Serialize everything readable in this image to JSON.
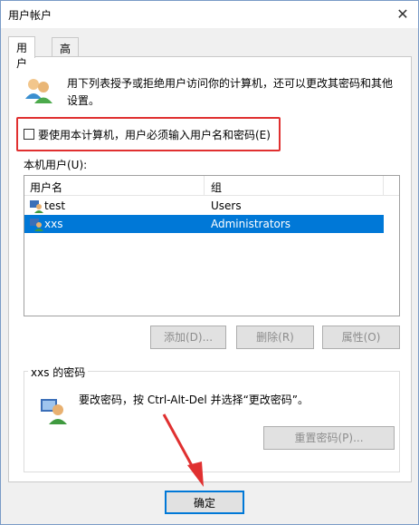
{
  "window": {
    "title": "用户帐户",
    "close_glyph": "✕"
  },
  "tabs": [
    {
      "label": "用户",
      "active": true
    },
    {
      "label": "高级",
      "active": false
    }
  ],
  "users_tab": {
    "description": "用下列表授予或拒绝用户访问你的计算机，还可以更改其密码和其他设置。",
    "require_login_checkbox": {
      "label": "要使用本计算机，用户必须输入用户名和密码(E)",
      "checked": false
    },
    "local_users_label": "本机用户(U):",
    "table": {
      "columns": [
        "用户名",
        "组"
      ],
      "rows": [
        {
          "name": "test",
          "group": "Users",
          "selected": false
        },
        {
          "name": "xxs",
          "group": "Administrators",
          "selected": true
        }
      ]
    },
    "buttons": {
      "add": "添加(D)...",
      "remove": "删除(R)",
      "properties": "属性(O)"
    },
    "password_group": {
      "title": "xxs 的密码",
      "text": "要改密码，按 Ctrl-Alt-Del 并选择“更改密码”。",
      "reset_button": "重置密码(P)..."
    }
  },
  "footer": {
    "ok_button": "确定"
  },
  "colors": {
    "selection": "#0078d7",
    "highlight_border": "#e03030",
    "annotation_arrow": "#e03030"
  },
  "icons": {
    "users": "users-icon",
    "user_row": "user-account-icon",
    "password": "user-key-icon",
    "close": "close-icon"
  }
}
